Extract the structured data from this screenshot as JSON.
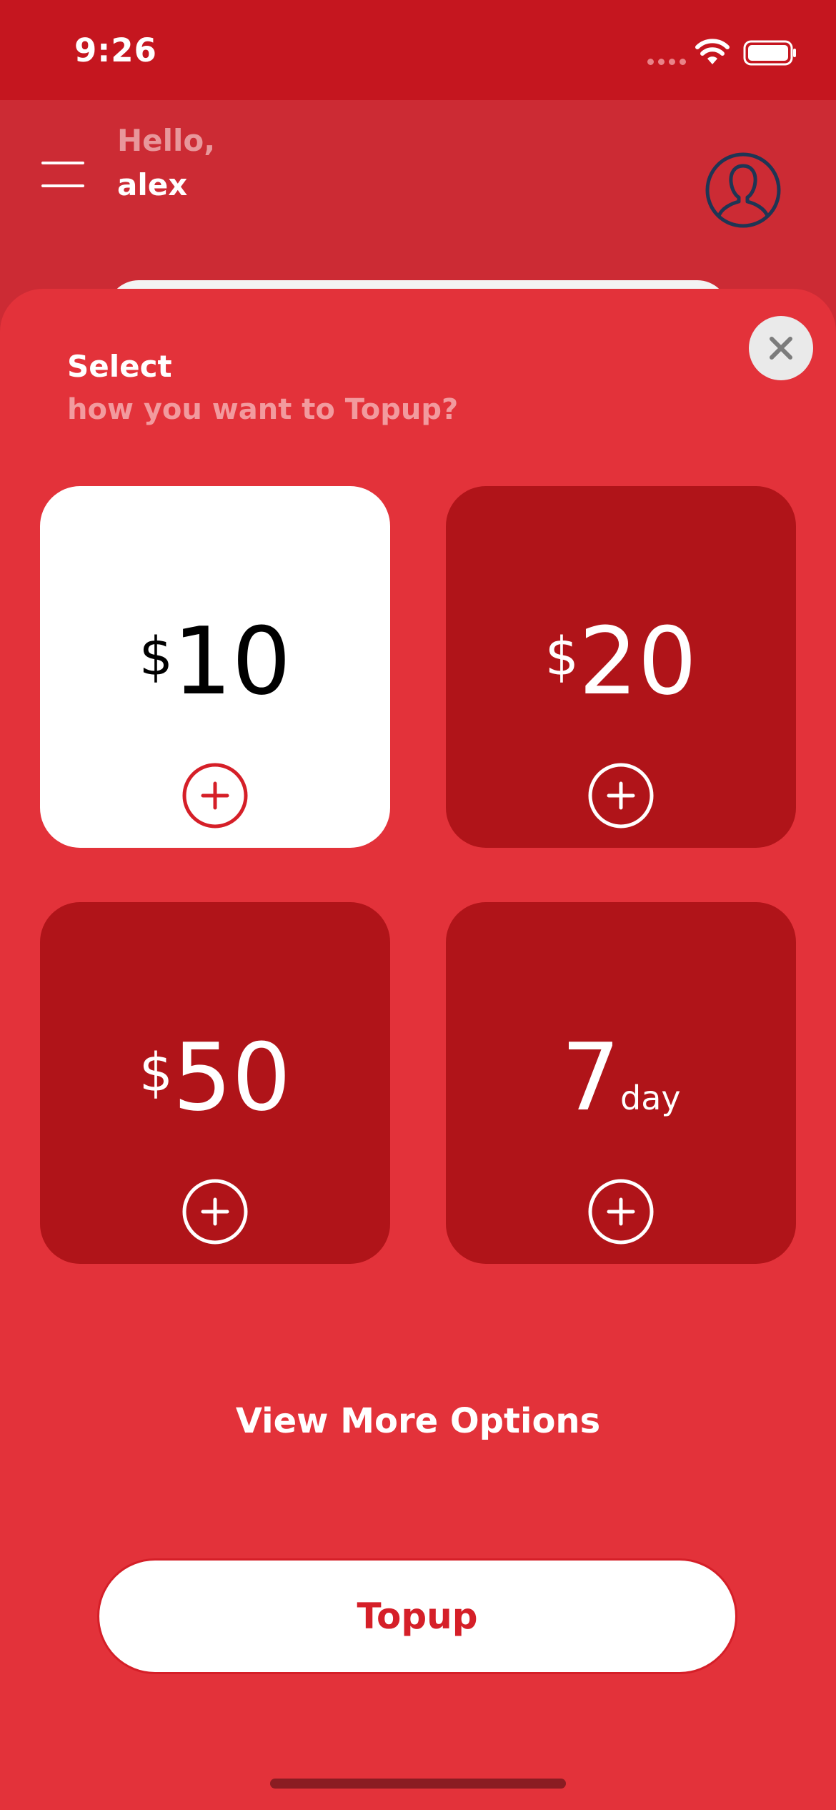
{
  "status_bar": {
    "time": "9:26",
    "icons": [
      "signal-icon",
      "wifi-icon",
      "battery-icon"
    ]
  },
  "header": {
    "greeting": "Hello,",
    "username": "alex",
    "icons": [
      "menu-icon",
      "profile-icon"
    ]
  },
  "sheet": {
    "title": "Select",
    "subtitle": "how you want to Topup?",
    "close_icon": "close-icon",
    "options": [
      {
        "prefix": "$",
        "value": "10",
        "suffix": "",
        "selected": true
      },
      {
        "prefix": "$",
        "value": "20",
        "suffix": "",
        "selected": false
      },
      {
        "prefix": "$",
        "value": "50",
        "suffix": "",
        "selected": false
      },
      {
        "prefix": "",
        "value": "7",
        "suffix": "day",
        "selected": false
      }
    ],
    "view_more_label": "View More Options",
    "topup_label": "Topup"
  },
  "colors": {
    "status_bar": "#c5161f",
    "header_bg": "#cc2b34",
    "sheet_bg": "#e3323a",
    "tile_bg": "#b01419",
    "tile_selected_bg": "#ffffff",
    "accent": "#d51f28"
  }
}
